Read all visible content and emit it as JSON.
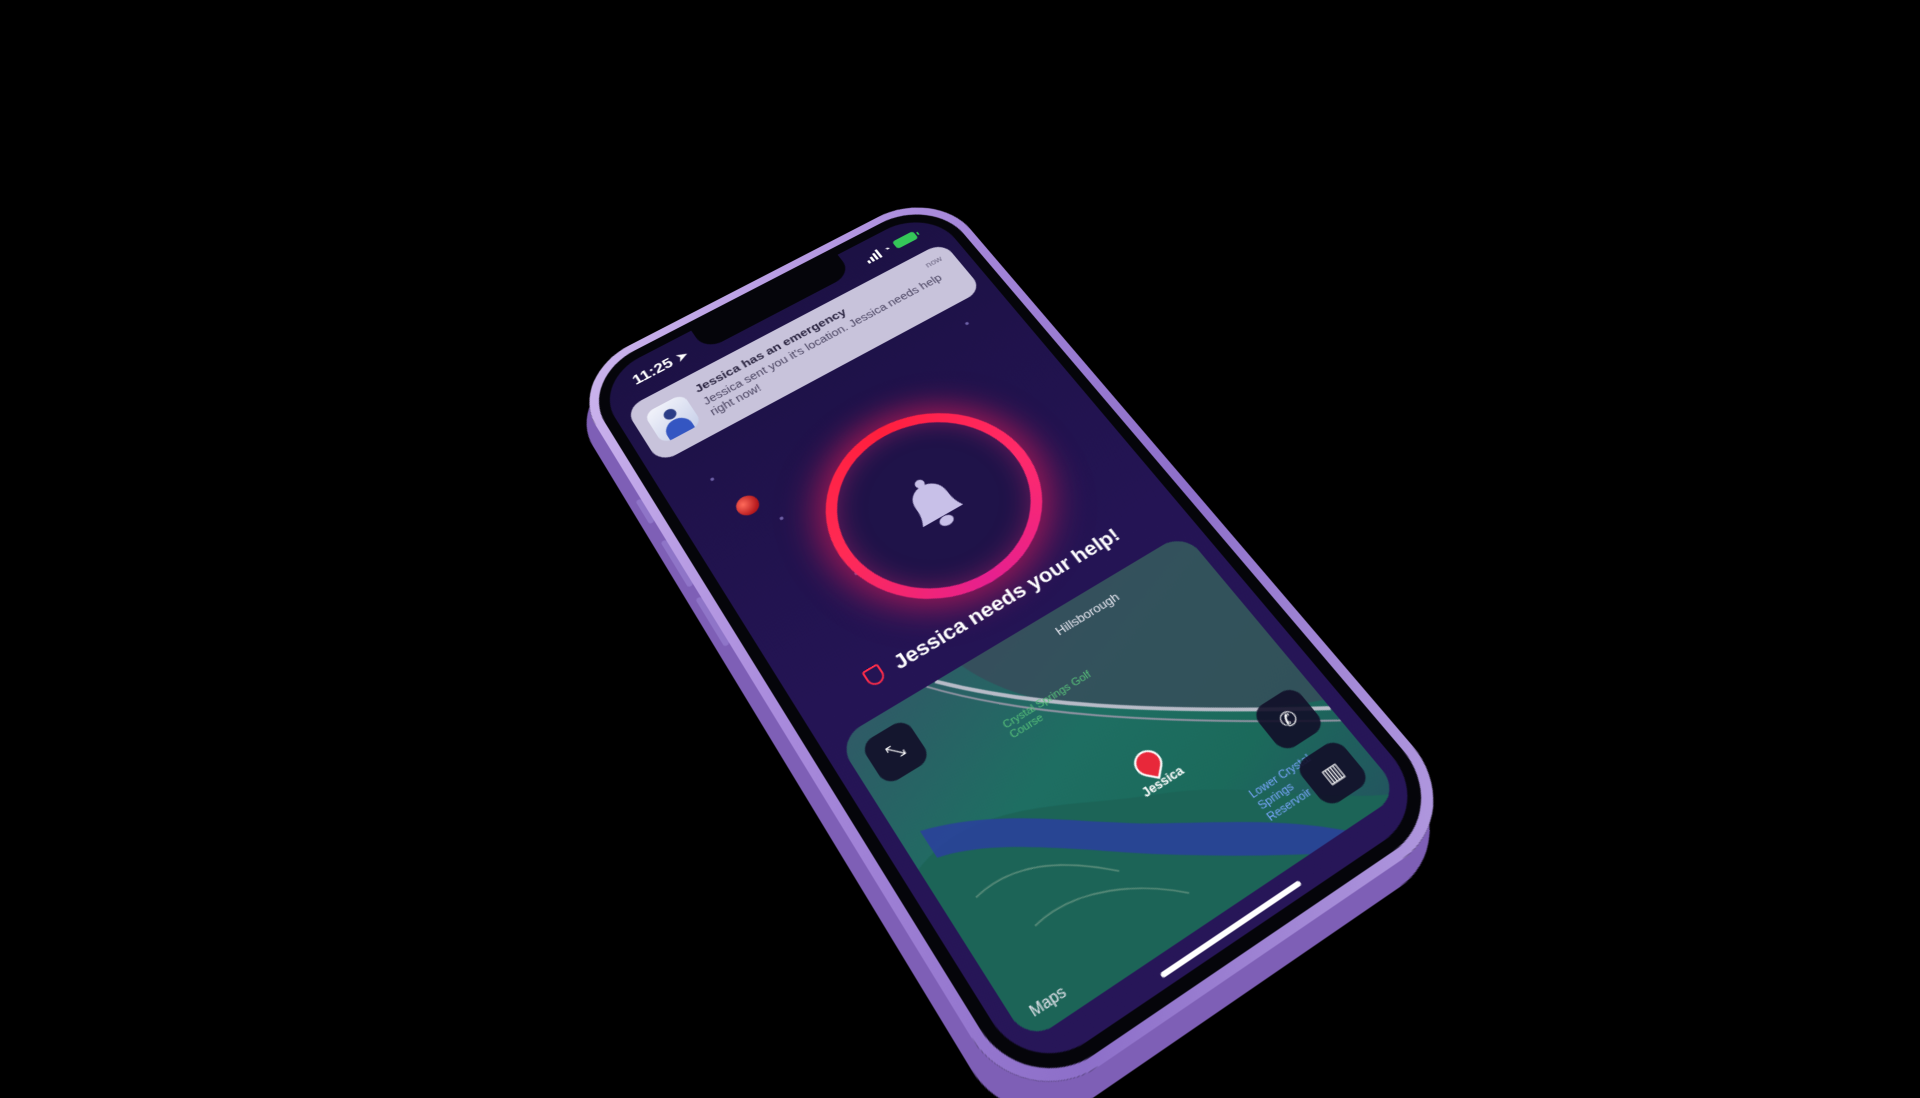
{
  "status_bar": {
    "time": "11:25"
  },
  "notification": {
    "title": "Jessica has an emergency",
    "body": "Jessica sent you it's location. Jessica needs help right now!",
    "time": "now"
  },
  "help_banner": {
    "text": "Jessica needs your help!"
  },
  "map": {
    "labels": {
      "city": "Hillsborough",
      "golf": "Crystal Springs Golf Course",
      "reservoir": "Lower Crystal Springs Reservoir"
    },
    "pin_label": "Jessica",
    "credit": "Maps"
  },
  "colors": {
    "background": "#000000",
    "phone_frame": "#a98bdc",
    "screen": "#1f1349",
    "ring": "#ff1f3d",
    "map": "#1e6e62",
    "pin": "#e8283a"
  },
  "icons": [
    "location-arrow-icon",
    "signal-icon",
    "wifi-icon",
    "battery-icon",
    "avatar-icon",
    "bell-icon",
    "shield-icon",
    "expand-icon",
    "phone-icon",
    "map-icon",
    "map-pin-icon"
  ]
}
